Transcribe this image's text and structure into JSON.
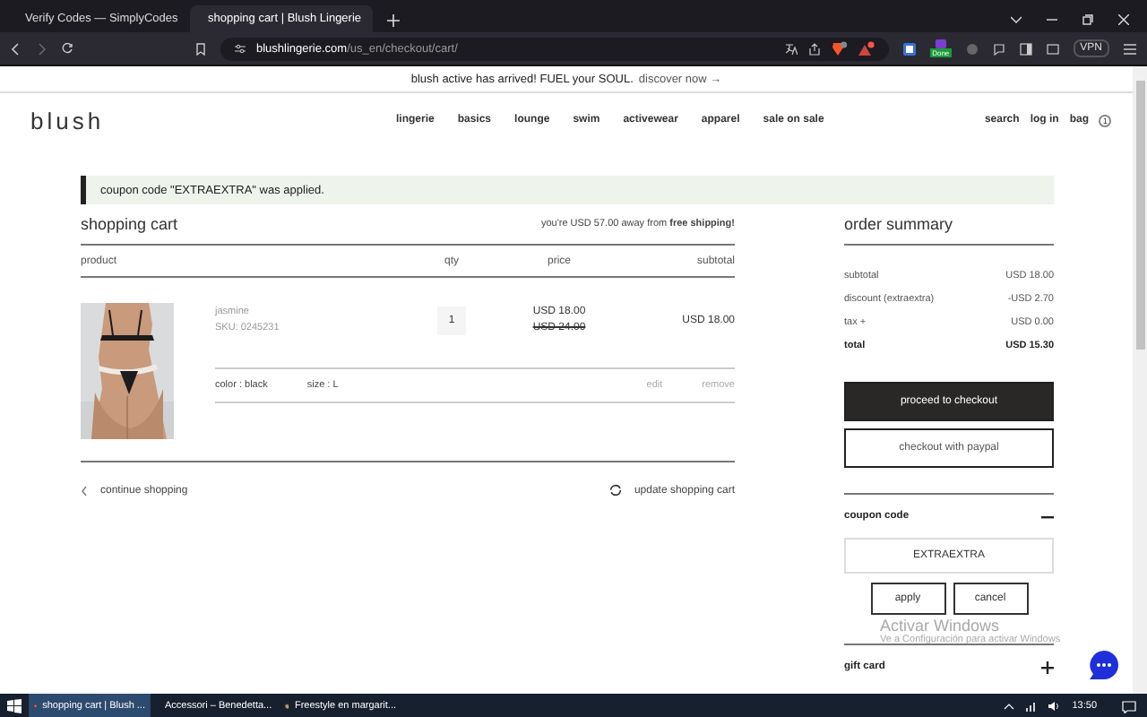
{
  "browser": {
    "tabs": [
      {
        "title": "Verify Codes — SimplyCodes",
        "selected": false
      },
      {
        "title": "shopping cart | Blush Lingerie",
        "selected": true
      }
    ],
    "url": {
      "domain": "blushlingerie.com",
      "path": "/us_en/checkout/cart/"
    },
    "extension_label": "Done",
    "vpn": "VPN"
  },
  "announcement": {
    "text": "blush active has arrived! FUEL your SOUL.",
    "link": "discover now →"
  },
  "header": {
    "logo": "blush",
    "nav": [
      "lingerie",
      "basics",
      "lounge",
      "swim",
      "activewear",
      "apparel",
      "sale on sale"
    ],
    "utilities": [
      "search",
      "log in"
    ],
    "bag": {
      "label": "bag",
      "count": "1"
    }
  },
  "message": "coupon code \"EXTRAEXTRA\" was applied.",
  "cart": {
    "title": "shopping cart",
    "shipping_note": "you're USD 57.00 away from **free shipping!**",
    "columns": [
      "product",
      "qty",
      "price",
      "subtotal"
    ],
    "items": [
      {
        "kind": "picture",
        "name": "jasmine",
        "sku": "SKU: 0245231",
        "qty": "1",
        "price": "USD 18.00",
        "original_price": "USD 24.00",
        "subtotal": "USD 18.00",
        "options": [
          "color : black",
          "size : L"
        ],
        "actions": [
          "edit",
          "remove"
        ]
      }
    ],
    "continue": "continue shopping",
    "update": "update shopping cart"
  },
  "summary": {
    "title": "order summary",
    "rows": [
      {
        "label": "subtotal",
        "value": "USD 18.00",
        "kind": "normal"
      },
      {
        "label": "discount (extraextra)",
        "value": "-USD 2.70",
        "kind": "normal"
      },
      {
        "label": "tax +",
        "value": "USD 0.00",
        "kind": "normal"
      },
      {
        "label": "total",
        "value": "USD 15.30",
        "kind": "total"
      }
    ],
    "checkout": "proceed to checkout",
    "paypal": "checkout with paypal",
    "sections": [
      {
        "title": "coupon code",
        "expanded": true,
        "value": "EXTRAEXTRA",
        "apply": "apply",
        "cancel": "cancel"
      },
      {
        "title": "gift card",
        "expanded": false
      }
    ]
  },
  "os_notice": {
    "title": "Activar Windows",
    "text": "Ve a Configuración para activar Windows"
  },
  "taskbar": {
    "items": [
      {
        "title": "shopping cart | Blush ...",
        "selected": true
      },
      {
        "title": "Accessori – Benedetta...",
        "selected": false
      },
      {
        "title": "Freestyle en margarit...",
        "selected": false
      }
    ],
    "time": "13:50"
  }
}
